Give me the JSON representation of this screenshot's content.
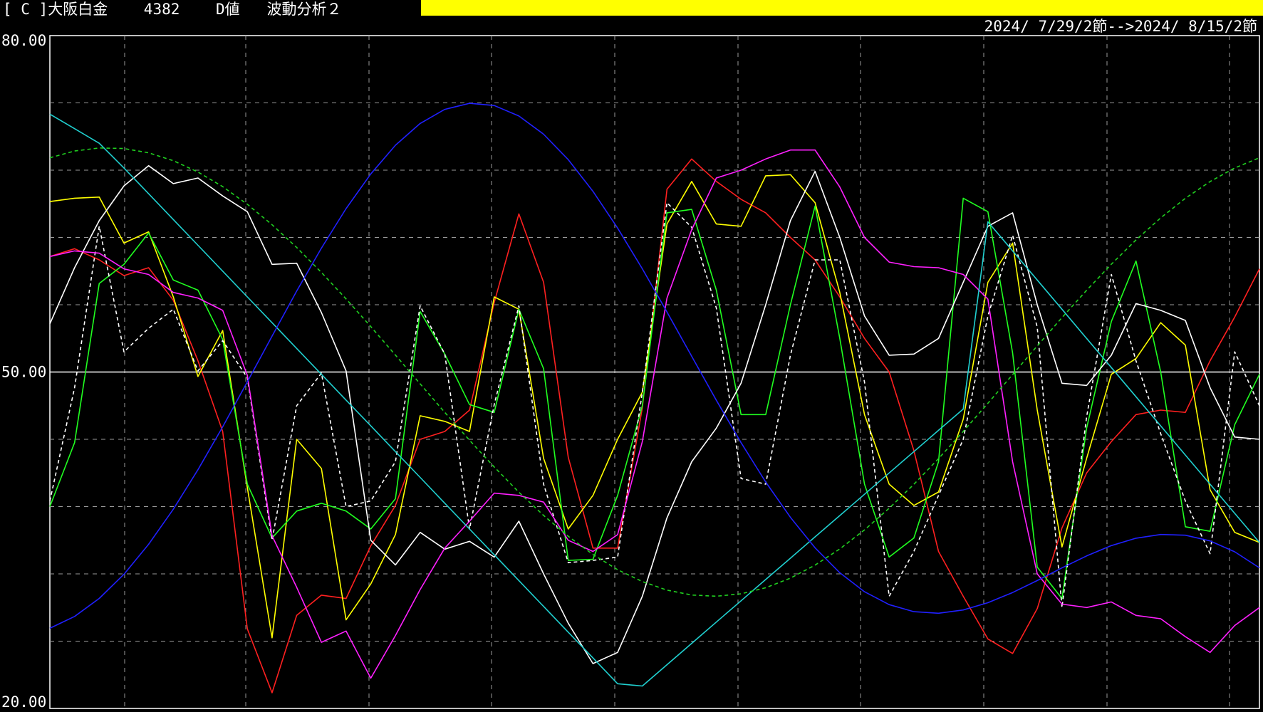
{
  "header": {
    "bracket": "[ C ]",
    "instrument": "大阪白金",
    "code": "4382",
    "value_type": "D値",
    "analysis": "波動分析２",
    "highlight_color": "#ffff00"
  },
  "range_label": "2024/ 7/29/2節-->2024/ 8/15/2節",
  "chart_data": {
    "type": "line",
    "ylim": [
      20,
      80
    ],
    "y_ticks": [
      "80.00",
      "50.00",
      "20.00"
    ],
    "center_line": 50,
    "grid": true,
    "x": [
      0,
      1,
      2,
      3,
      4,
      5,
      6,
      7,
      8,
      9,
      10,
      11,
      12,
      13,
      14,
      15,
      16,
      17,
      18,
      19,
      20,
      21,
      22,
      23,
      24,
      25,
      26,
      27,
      28,
      29,
      30,
      31,
      32,
      33,
      34,
      35,
      36,
      37,
      38,
      39,
      40,
      41,
      42,
      43,
      44,
      45,
      46,
      47,
      48,
      49
    ],
    "series": [
      {
        "color": "#ff2020",
        "dash": false,
        "values": [
          60.3,
          61,
          60,
          58.6,
          59.3,
          56.4,
          51,
          44.7,
          27.1,
          21.4,
          28.3,
          30.1,
          29.8,
          34.5,
          38.1,
          44,
          44.7,
          46.6,
          56.2,
          64.1,
          58,
          42.4,
          34.3,
          34.3,
          46.8,
          66.3,
          69,
          67,
          65.4,
          64.2,
          62,
          60,
          56.7,
          53,
          50,
          43,
          34,
          30,
          26.2,
          24.9,
          28.9,
          36.1,
          41,
          43.8,
          46.2,
          46.6,
          46.4,
          51,
          54.9,
          59.2
        ]
      },
      {
        "color": "#ffff00",
        "dash": false,
        "values": [
          65.2,
          65.5,
          65.6,
          61.5,
          62.5,
          56.7,
          49.6,
          53.7,
          39.7,
          26.3,
          44,
          41.4,
          27.9,
          31.1,
          35.5,
          46.1,
          45.6,
          44.7,
          56.7,
          55.6,
          42.3,
          36,
          39,
          44,
          48.2,
          63.2,
          67,
          63.2,
          63,
          67.5,
          67.6,
          65.1,
          57.1,
          46.2,
          40,
          38.1,
          39.3,
          45.8,
          58,
          61.5,
          46.6,
          34.4,
          42.3,
          49.8,
          51.2,
          54.4,
          52.4,
          39.5,
          35.7,
          34.8
        ]
      },
      {
        "color": "#20ff20",
        "dash": false,
        "values": [
          38,
          43.7,
          57.9,
          59.6,
          62.4,
          58.2,
          57.3,
          52.9,
          40,
          35.2,
          37.6,
          38.3,
          37.6,
          36,
          38.7,
          55.4,
          51.6,
          47.1,
          46.4,
          55.6,
          50.3,
          33.2,
          33.3,
          39,
          47,
          64.2,
          64.5,
          57.3,
          46.2,
          46.2,
          56,
          64.8,
          53,
          40,
          33.5,
          35.2,
          42,
          65.5,
          64.3,
          51.7,
          32.6,
          29.8,
          45,
          54.5,
          59.9,
          50,
          36.2,
          35.8,
          45.3,
          49.8
        ]
      },
      {
        "color": "#ffffff",
        "dash": false,
        "values": [
          54.3,
          59.3,
          63.5,
          66.6,
          68.4,
          66.8,
          67.3,
          65.7,
          64.3,
          59.6,
          59.7,
          55.3,
          50.1,
          35,
          32.8,
          35.7,
          34.2,
          34.9,
          33.5,
          36.7,
          32,
          27.6,
          24,
          25,
          30,
          37,
          42,
          45,
          49,
          56,
          63.5,
          67.9,
          62,
          55,
          51.5,
          51.6,
          53,
          58,
          63,
          64.2,
          56,
          49,
          48.8,
          51.5,
          56.1,
          55.5,
          54.6,
          48.6,
          44.2,
          44
        ]
      },
      {
        "color": "#ffffff",
        "dash": true,
        "values": [
          38.5,
          48.6,
          63,
          51.8,
          53.9,
          55.6,
          50.1,
          52.8,
          49.5,
          35,
          47,
          49.9,
          38,
          38.5,
          42,
          55.9,
          51.6,
          36,
          47.1,
          55.9,
          40,
          33,
          33.2,
          33.5,
          48.2,
          65.1,
          62.9,
          55.7,
          40.5,
          40,
          51.5,
          60,
          60,
          49.1,
          30,
          34,
          39,
          44,
          55,
          62.2,
          54,
          29,
          46,
          58.7,
          51,
          44.5,
          38.5,
          33.8,
          51.8,
          47
        ]
      },
      {
        "color": "#ff20ff",
        "dash": false,
        "values": [
          60.3,
          60.8,
          60.6,
          59.2,
          58.7,
          57.1,
          56.6,
          55.5,
          49.7,
          35.4,
          30.8,
          25.9,
          26.9,
          22.7,
          26.5,
          30.6,
          34.3,
          36.7,
          39.2,
          39,
          38.4,
          35,
          34,
          35.5,
          43.8,
          56.6,
          62.7,
          67.3,
          68,
          69,
          69.8,
          69.8,
          66.5,
          62,
          59.8,
          59.4,
          59.3,
          58.7,
          56.5,
          42,
          32,
          29.3,
          29,
          29.5,
          28.3,
          28,
          26.4,
          25,
          27.4,
          29
        ]
      },
      {
        "color": "#20d0d0",
        "dash": false,
        "values": null
      },
      {
        "color": "#2020ff",
        "dash": false,
        "values": null
      },
      {
        "color": "#20d020",
        "dash": true,
        "values": null
      }
    ]
  }
}
